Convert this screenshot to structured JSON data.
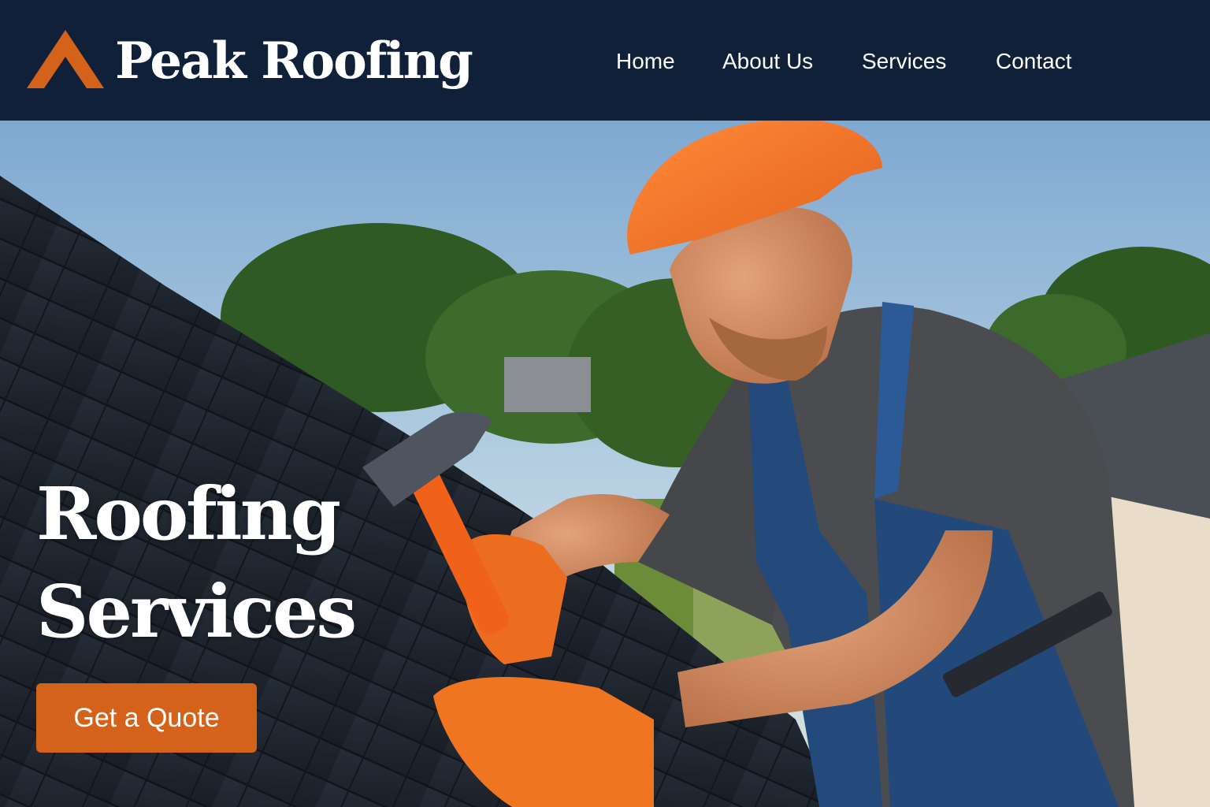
{
  "brand": {
    "name": "Peak Roofing",
    "logo_icon": "roof-peak-icon",
    "accent_color": "#d4621a",
    "header_color": "#112039"
  },
  "nav": {
    "items": [
      {
        "label": "Home"
      },
      {
        "label": "About Us"
      },
      {
        "label": "Services"
      },
      {
        "label": "Contact"
      }
    ]
  },
  "hero": {
    "title_line1": "Roofing",
    "title_line2": "Services",
    "cta_label": "Get a Quote",
    "image": "roofer-hammering-shingles-photo"
  }
}
